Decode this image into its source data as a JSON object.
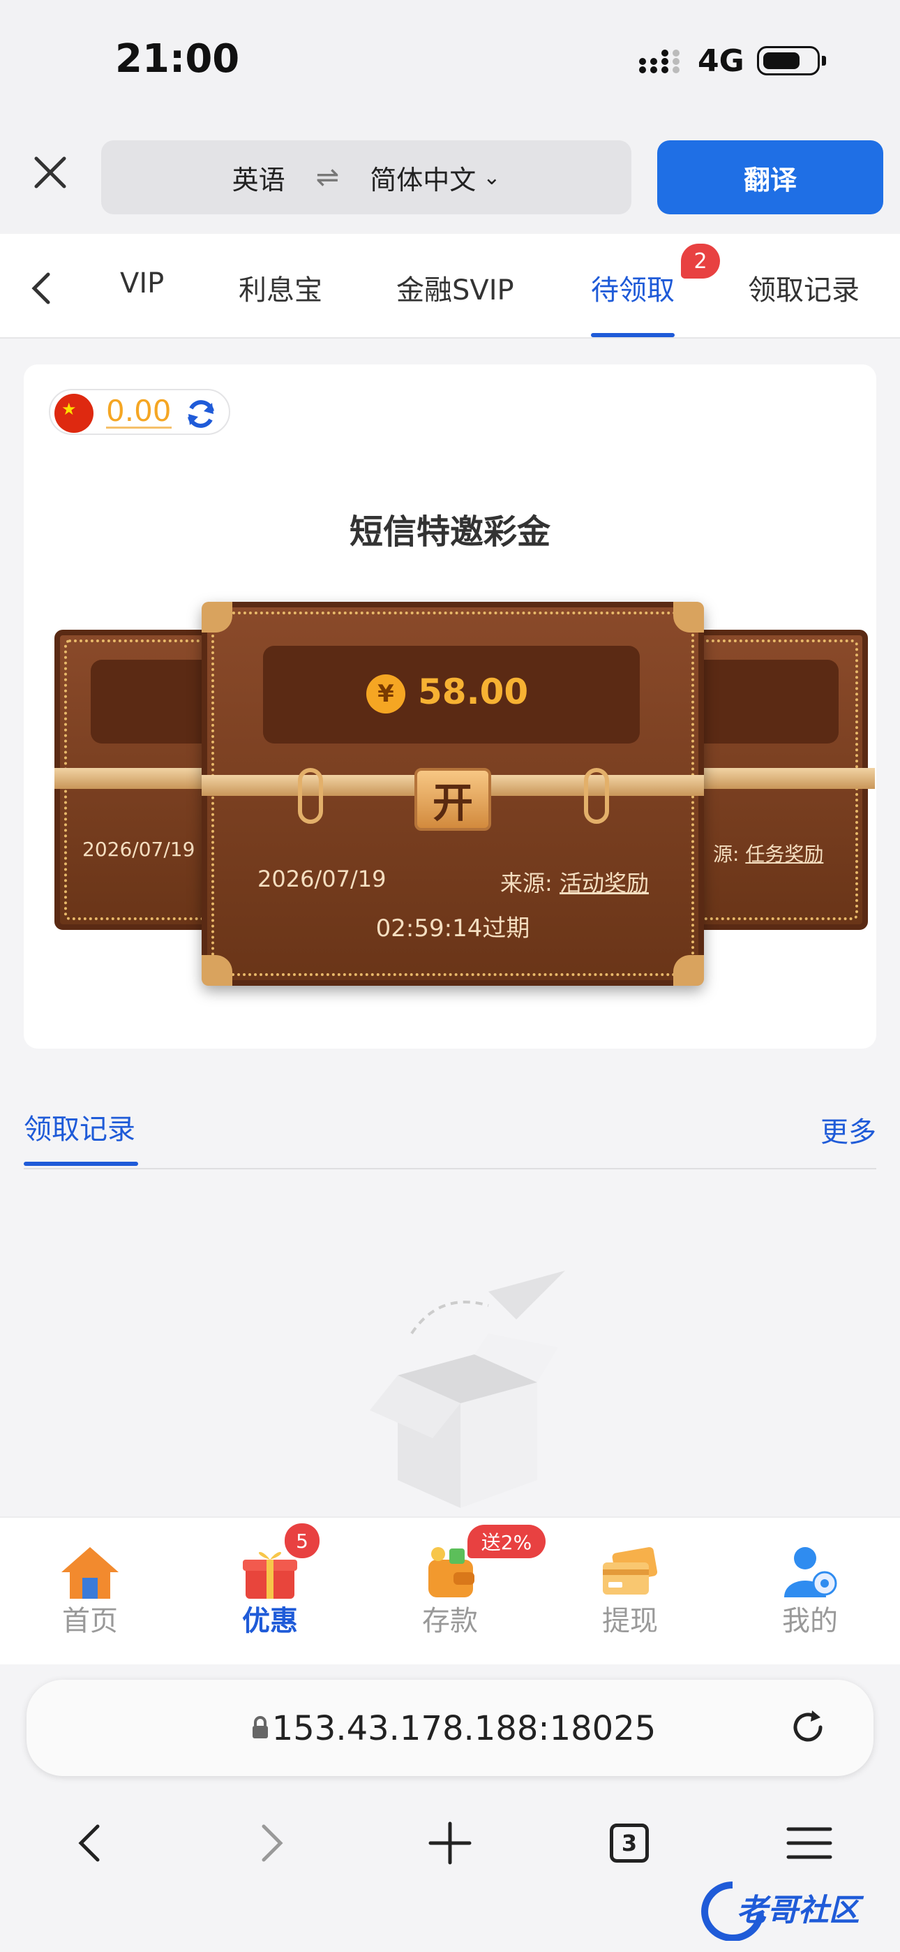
{
  "status_bar": {
    "time": "21:00",
    "network": "4G"
  },
  "translate_bar": {
    "source_lang": "英语",
    "target_lang": "简体中文",
    "translate_label": "翻译"
  },
  "tabs": {
    "items": [
      "VIP",
      "利息宝",
      "金融SVIP",
      "待领取",
      "领取记录"
    ],
    "active": "待领取",
    "badge": "2"
  },
  "card": {
    "balance": "0.00",
    "title": "短信特邀彩金",
    "chest": {
      "amount": "58.00",
      "currency_symbol": "¥",
      "date": "2026/07/19",
      "source_label": "来源:",
      "source_value": "活动奖励",
      "expiry": "02:59:14过期",
      "open_label": "开"
    },
    "left_chest_date": "2026/07/19",
    "right_chest_source_label": "源:",
    "right_chest_source_value": "任务奖励"
  },
  "records": {
    "tab_label": "领取记录",
    "more_label": "更多"
  },
  "bottom_nav": {
    "items": [
      {
        "label": "首页",
        "icon": "home-icon"
      },
      {
        "label": "优惠",
        "icon": "gift-icon",
        "badge": "5"
      },
      {
        "label": "存款",
        "icon": "wallet-icon",
        "badge": "送2%"
      },
      {
        "label": "提现",
        "icon": "card-icon"
      },
      {
        "label": "我的",
        "icon": "user-icon"
      }
    ],
    "active": "优惠"
  },
  "browser": {
    "url": "153.43.178.188:18025",
    "tab_count": "3"
  },
  "watermark": {
    "text": "老哥社区"
  },
  "colors": {
    "accent": "#1f5bd8",
    "translate_button": "#1f6fe5",
    "badge": "#e84141",
    "coin": "#f5a623"
  }
}
